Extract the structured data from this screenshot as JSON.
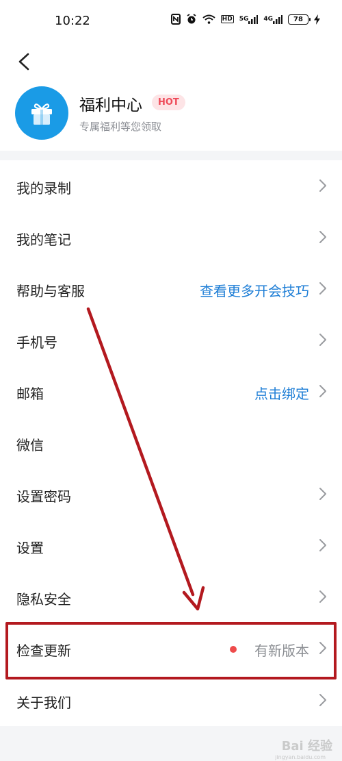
{
  "status_bar": {
    "time": "10:22",
    "net1": "5G",
    "net2": "4G",
    "hd": "HD",
    "battery": "78",
    "icons": [
      "nfc-icon",
      "alarm-icon",
      "wifi-icon",
      "hd-icon",
      "signal-5g-icon",
      "signal-4g-icon",
      "battery-icon",
      "charging-icon"
    ]
  },
  "profile": {
    "title": "福利中心",
    "badge": "HOT",
    "subtitle": "专属福利等您领取",
    "icon": "gift-icon"
  },
  "menu": {
    "recordings": {
      "label": "我的录制"
    },
    "notes": {
      "label": "我的笔记"
    },
    "help": {
      "label": "帮助与客服",
      "extra": "查看更多开会技巧"
    },
    "phone": {
      "label": "手机号"
    },
    "email": {
      "label": "邮箱",
      "extra": "点击绑定"
    },
    "wechat": {
      "label": "微信"
    },
    "password": {
      "label": "设置密码"
    },
    "settings": {
      "label": "设置"
    },
    "privacy": {
      "label": "隐私安全"
    },
    "update": {
      "label": "检查更新",
      "extra": "有新版本"
    },
    "about": {
      "label": "关于我们"
    }
  },
  "colors": {
    "accent": "#1e7ed6",
    "badge_text": "#ee4b59",
    "badge_bg": "#fde4e6",
    "annotation": "#b3191f",
    "avatar": "#1a9be6"
  },
  "watermark": {
    "main": "Bai 经验",
    "sub": "jingyan.baidu.com"
  }
}
